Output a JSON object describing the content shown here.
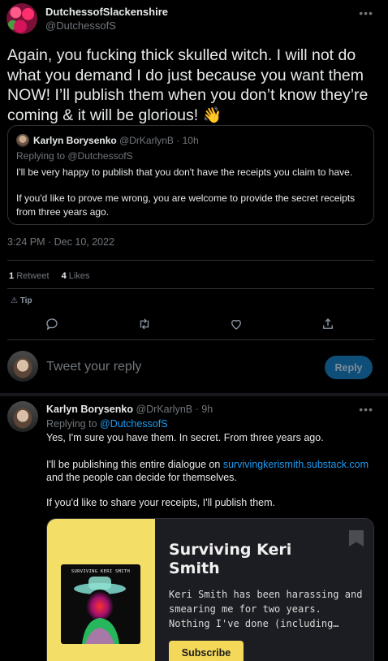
{
  "tweet": {
    "author_name": "DutchessofSlackenshire",
    "author_handle": "@DutchessofS",
    "body": "Again, you fucking thick skulled witch.  I will not do what you demand I do just because you want them NOW!  I’ll publish them when you don’t know they’re coming & it will be glorious!",
    "emoji": "👋",
    "timestamp": "3:24 PM · Dec 10, 2022",
    "retweets_count": "1",
    "retweets_label": "Retweet",
    "likes_count": "4",
    "likes_label": "Likes",
    "tip_label": "Tip"
  },
  "quoted": {
    "author_name": "Karlyn Borysenko",
    "author_handle": "@DrKarlynB",
    "age": "· 10h",
    "replying_to": "Replying to @DutchessofS",
    "para1": "I'll be very happy to publish that you don't have the receipts you claim to have.",
    "para2": "If you'd like to prove me wrong, you are welcome to provide the secret receipts from three years ago."
  },
  "composer": {
    "placeholder": "Tweet your reply",
    "reply_button": "Reply"
  },
  "reply": {
    "author_name": "Karlyn Borysenko",
    "author_handle": "@DrKarlynB",
    "age": "· 9h",
    "replying_prefix": "Replying to ",
    "replying_handle": "@DutchessofS",
    "para1": "Yes, I'm sure you have them. In secret. From three years ago.",
    "para2_prefix": "I'll be publishing this entire dialogue on ",
    "para2_link": "survivingkerismith.substack.com",
    "para2_suffix": "and the people can decide for themselves.",
    "para3": "If you'd like to share your receipts, I'll publish them."
  },
  "card": {
    "album_title": "SURVIVING KERI SMITH",
    "title": "Surviving Keri Smith",
    "description": "Keri Smith has been harassing and smearing me for two years. Nothing I've done (including…",
    "subscribe_label": "Subscribe"
  },
  "icons": [
    "more-icon",
    "reply-icon",
    "retweet-icon",
    "like-icon",
    "share-icon",
    "tip-icon",
    "bookmark-icon"
  ],
  "colors": {
    "link": "#1d9bf0",
    "reply_button_bg": "#0f4e78",
    "card_accent": "#f3de68"
  }
}
